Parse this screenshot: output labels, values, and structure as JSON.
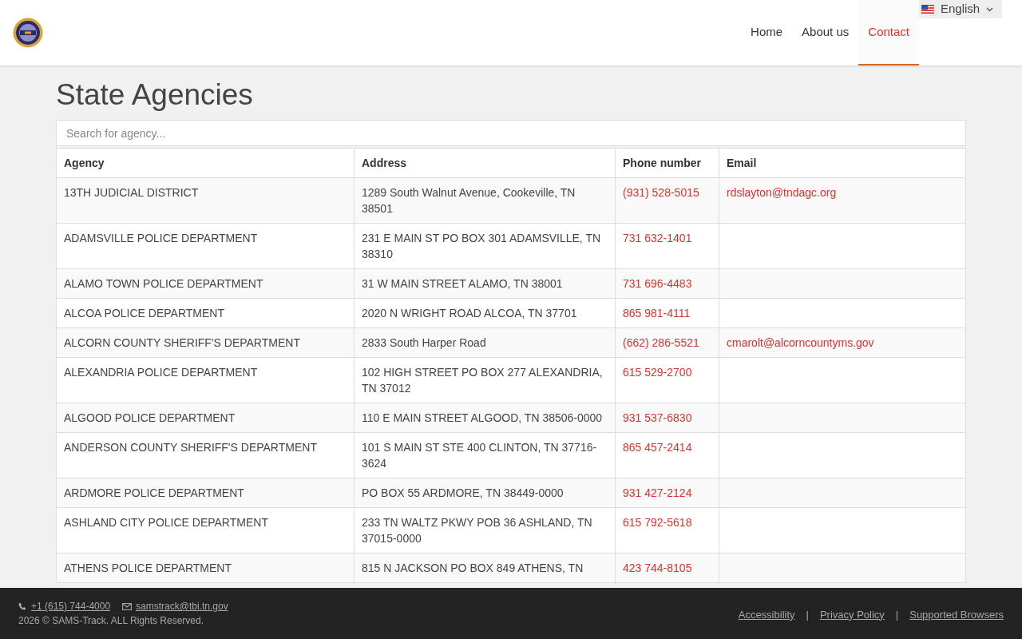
{
  "header": {
    "language": "English",
    "nav": [
      {
        "label": "Home",
        "selected": false
      },
      {
        "label": "About us",
        "selected": false
      },
      {
        "label": "Contact",
        "selected": true
      }
    ]
  },
  "title": "State Agencies",
  "search": {
    "placeholder": "Search for agency..."
  },
  "table": {
    "columns": [
      "Agency",
      "Address",
      "Phone number",
      "Email"
    ],
    "rows": [
      {
        "agency": "13TH JUDICIAL DISTRICT",
        "address": "1289 South Walnut Avenue, Cookeville, TN 38501",
        "phone": "(931) 528-5015",
        "email": "rdslayton@tndagc.org"
      },
      {
        "agency": "ADAMSVILLE POLICE DEPARTMENT",
        "address": "231 E MAIN ST PO BOX 301 ADAMSVILLE, TN 38310",
        "phone": "731 632-1401"
      },
      {
        "agency": "ALAMO TOWN POLICE DEPARTMENT",
        "address": "31 W MAIN STREET ALAMO, TN 38001",
        "phone": "731 696-4483"
      },
      {
        "agency": "ALCOA POLICE DEPARTMENT",
        "address": "2020 N WRIGHT ROAD ALCOA, TN 37701",
        "phone": "865 981-4111"
      },
      {
        "agency": "ALCORN COUNTY SHERIFF'S DEPARTMENT",
        "address": "2833 South Harper Road",
        "phone": "(662) 286-5521",
        "email": "cmarolt@alcorncountyms.gov"
      },
      {
        "agency": "ALEXANDRIA POLICE DEPARTMENT",
        "address": "102 HIGH STREET PO BOX 277 ALEXANDRIA, TN 37012",
        "phone": "615 529-2700"
      },
      {
        "agency": "ALGOOD POLICE DEPARTMENT",
        "address": "110 E MAIN STREET ALGOOD, TN 38506-0000",
        "phone": "931 537-6830"
      },
      {
        "agency": "ANDERSON COUNTY SHERIFF'S DEPARTMENT",
        "address": "101 S MAIN ST STE 400 CLINTON, TN 37716-3624",
        "phone": "865 457-2414"
      },
      {
        "agency": "ARDMORE POLICE DEPARTMENT",
        "address": "PO BOX 55 ARDMORE, TN 38449-0000",
        "phone": "931 427-2124"
      },
      {
        "agency": "ASHLAND CITY POLICE DEPARTMENT",
        "address": "233 TN WALTZ PKWY POB 36 ASHLAND, TN 37015-0000",
        "phone": "615 792-5618"
      },
      {
        "agency": "ATHENS POLICE DEPARTMENT",
        "address": "815 N JACKSON PO BOX 849 ATHENS, TN",
        "phone": "423 744-8105"
      }
    ]
  },
  "footer": {
    "phone": "+1 (615) 744-4000",
    "email": "samstrack@tbi.tn.gov",
    "copyright": "2026 © SAMS-Track. ALL Rights Reserved.",
    "links": [
      "Accessibility",
      "Privacy Policy",
      "Supported Browsers"
    ],
    "separators": [
      "|",
      "|"
    ]
  }
}
